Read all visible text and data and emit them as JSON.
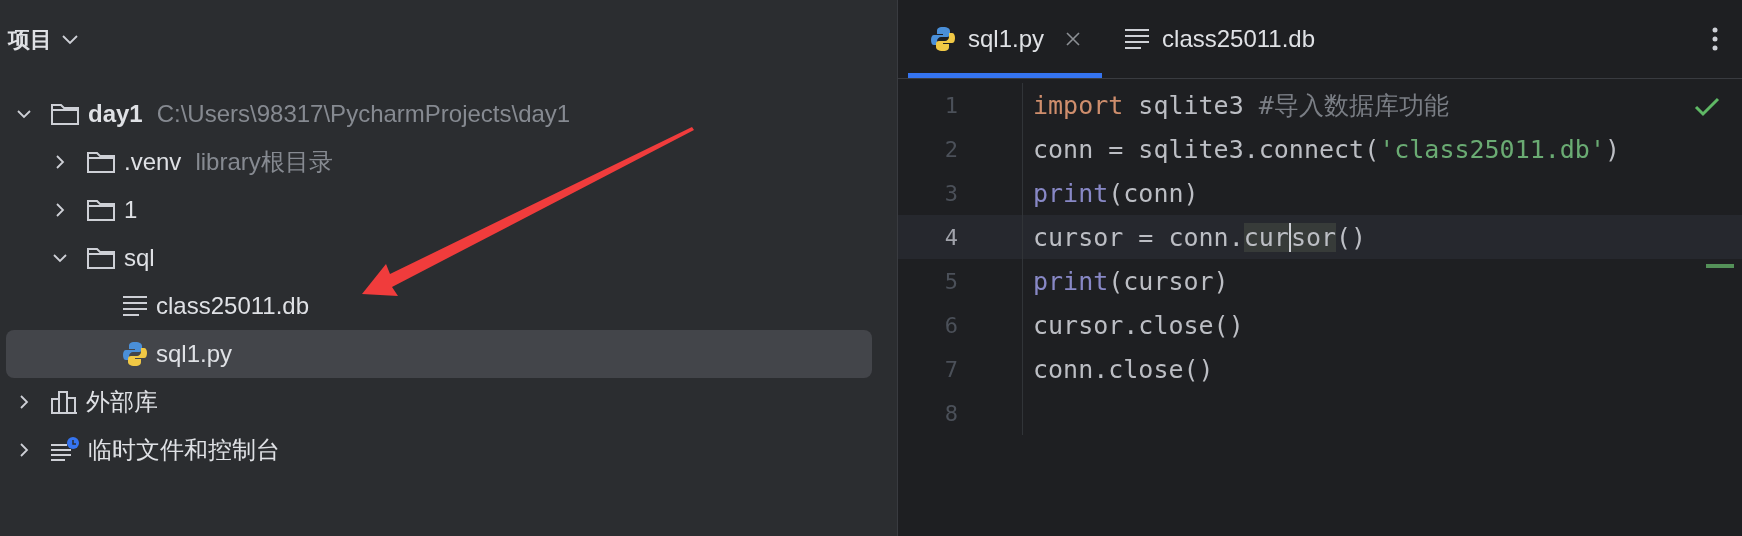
{
  "project_panel": {
    "title": "项目",
    "tree": [
      {
        "label": "day1",
        "kind": "folder",
        "hint": "C:\\Users\\98317\\PycharmProjects\\day1",
        "expanded": true,
        "selected": false,
        "children": [
          {
            "label": ".venv",
            "kind": "folder",
            "hint": "library根目录",
            "expanded": false,
            "selected": false
          },
          {
            "label": "1",
            "kind": "folder",
            "expanded": false,
            "selected": false
          },
          {
            "label": "sql",
            "kind": "folder",
            "expanded": true,
            "selected": false,
            "children": [
              {
                "label": "class25011.db",
                "kind": "text",
                "selected": false
              },
              {
                "label": "sql1.py",
                "kind": "python",
                "selected": true
              }
            ]
          }
        ]
      },
      {
        "label": "外部库",
        "kind": "library",
        "expanded": false,
        "selected": false
      },
      {
        "label": "临时文件和控制台",
        "kind": "scratches",
        "expanded": false,
        "selected": false
      }
    ]
  },
  "editor": {
    "tabs": [
      {
        "label": "sql1.py",
        "kind": "python",
        "selected": true,
        "closable": true
      },
      {
        "label": "class25011.db",
        "kind": "text",
        "selected": false,
        "closable": false
      }
    ],
    "lines": [
      {
        "number": "1",
        "current": false,
        "tokens": [
          {
            "text": "import",
            "kind": "keyword"
          },
          {
            "text": " sqlite3 ",
            "kind": "plain"
          },
          {
            "text": "#导入数据库功能",
            "kind": "comment"
          }
        ]
      },
      {
        "number": "2",
        "current": false,
        "tokens": [
          {
            "text": "conn = sqlite3.connect(",
            "kind": "plain"
          },
          {
            "text": "'class25011.db'",
            "kind": "string"
          },
          {
            "text": ")",
            "kind": "plain"
          }
        ]
      },
      {
        "number": "3",
        "current": false,
        "tokens": [
          {
            "text": "print",
            "kind": "builtin"
          },
          {
            "text": "(conn)",
            "kind": "plain"
          }
        ]
      },
      {
        "number": "4",
        "current": true,
        "tokens": [
          {
            "text": "cursor = conn.",
            "kind": "plain"
          },
          {
            "text": "cur",
            "kind": "usage"
          },
          {
            "text": "sor",
            "kind": "usage",
            "caret_before": true
          },
          {
            "text": "()",
            "kind": "plain"
          }
        ]
      },
      {
        "number": "5",
        "current": false,
        "tokens": [
          {
            "text": "print",
            "kind": "builtin"
          },
          {
            "text": "(cursor)",
            "kind": "plain"
          }
        ]
      },
      {
        "number": "6",
        "current": false,
        "tokens": [
          {
            "text": "cursor.close()",
            "kind": "plain"
          }
        ]
      },
      {
        "number": "7",
        "current": false,
        "tokens": [
          {
            "text": "conn.close()",
            "kind": "plain"
          }
        ]
      },
      {
        "number": "8",
        "current": false
      }
    ]
  }
}
